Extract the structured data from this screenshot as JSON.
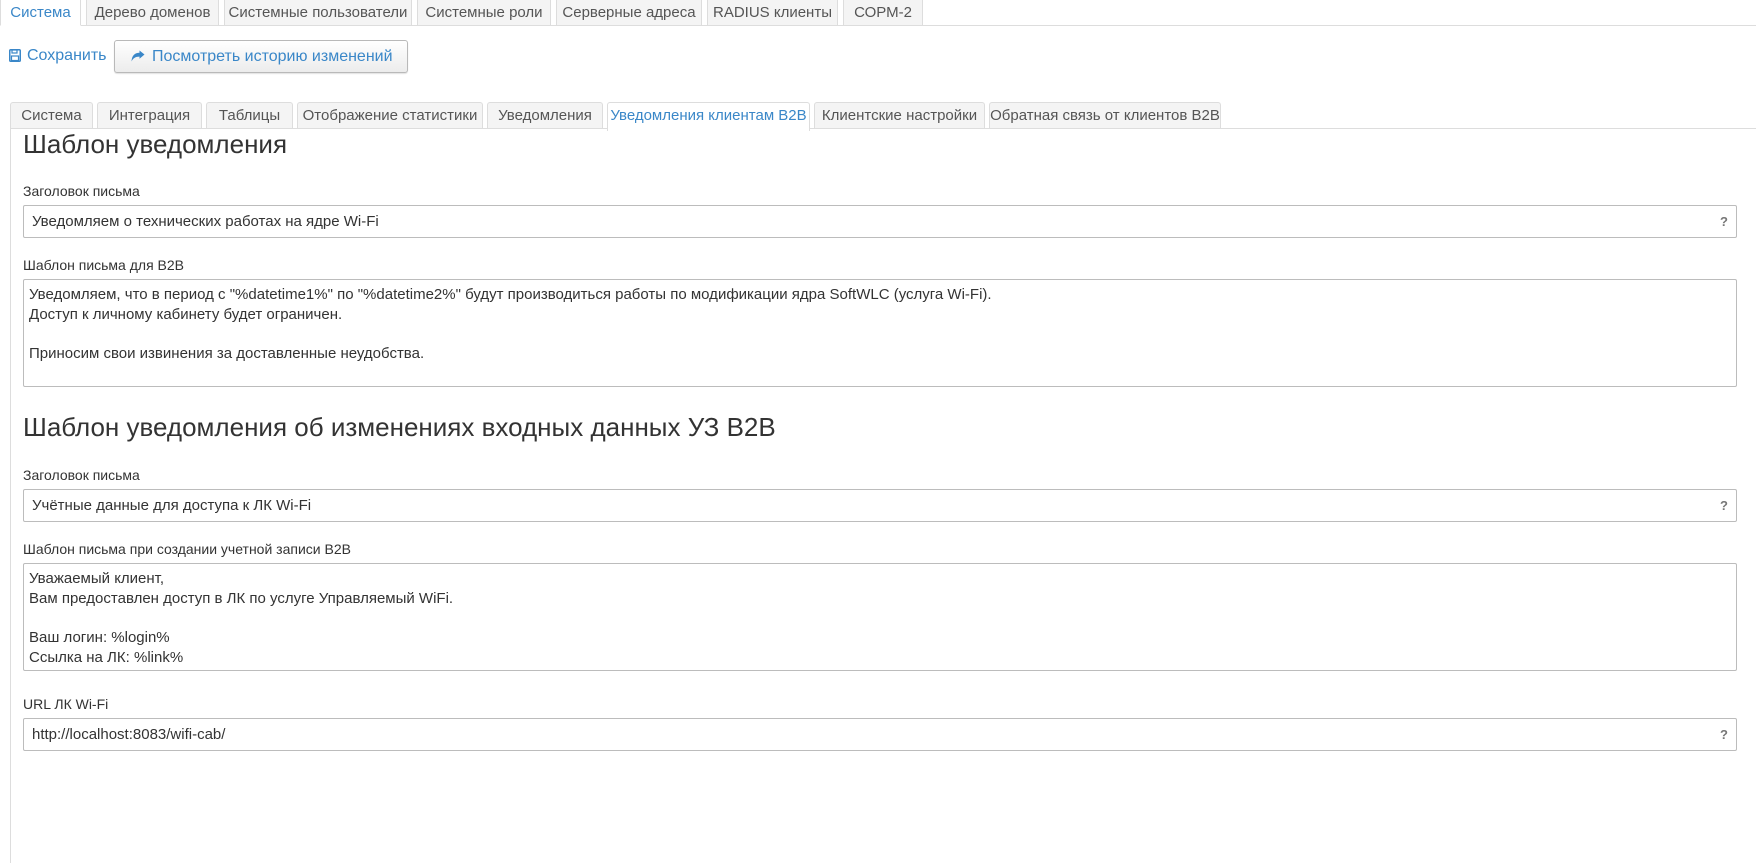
{
  "top_tabs": [
    {
      "label": "Система",
      "active": true
    },
    {
      "label": "Дерево доменов",
      "active": false
    },
    {
      "label": "Системные пользователи",
      "active": false
    },
    {
      "label": "Системные роли",
      "active": false
    },
    {
      "label": "Серверные адреса",
      "active": false
    },
    {
      "label": "RADIUS клиенты",
      "active": false
    },
    {
      "label": "СОРМ-2",
      "active": false
    }
  ],
  "toolbar": {
    "save_label": "Сохранить",
    "save_icon": "floppy-disk-icon",
    "history_label": "Посмотреть историю изменений",
    "history_icon": "share-arrow-icon"
  },
  "sub_tabs": [
    {
      "label": "Система",
      "active": false
    },
    {
      "label": "Интеграция",
      "active": false
    },
    {
      "label": "Таблицы",
      "active": false
    },
    {
      "label": "Отображение статистики",
      "active": false
    },
    {
      "label": "Уведомления",
      "active": false
    },
    {
      "label": "Уведомления клиентам B2B",
      "active": true
    },
    {
      "label": "Клиентские настройки",
      "active": false
    },
    {
      "label": "Обратная связь от клиентов B2B",
      "active": false
    }
  ],
  "notification_template": {
    "title": "Шаблон уведомления",
    "subject_label": "Заголовок письма",
    "subject_value": "Уведомляем о технических работах на ядре Wi-Fi",
    "body_label": "Шаблон письма для B2B",
    "body_lines": [
      "Уведомляем, что в период с \"%datetime1%\" по \"%datetime2%\" будут производиться работы по модификации ядра SoftWLC (услуга Wi-Fi).",
      "Доступ к личному кабинету будет ограничен.",
      "",
      "Приносим свои извинения за доставленные неудобства."
    ]
  },
  "account_template": {
    "title": "Шаблон уведомления об изменениях входных данных УЗ B2B",
    "subject_label": "Заголовок письма",
    "subject_value": "Учётные данные для доступа к ЛК Wi-Fi",
    "body_label": "Шаблон письма при создании учетной записи B2B",
    "body_lines": [
      "Уважаемый клиент,",
      "Вам предоставлен доступ в ЛК по услуге Управляемый WiFi.",
      "",
      "Ваш логин: %login%",
      "Ссылка на ЛК: %link%"
    ],
    "url_label": "URL ЛК Wi-Fi",
    "url_value": "http://localhost:8083/wifi-cab/"
  },
  "help_symbol": "?",
  "colors": {
    "accent": "#3a87c8",
    "tab_inactive_bg": "#f4f4f4",
    "border": "#dddddd"
  }
}
